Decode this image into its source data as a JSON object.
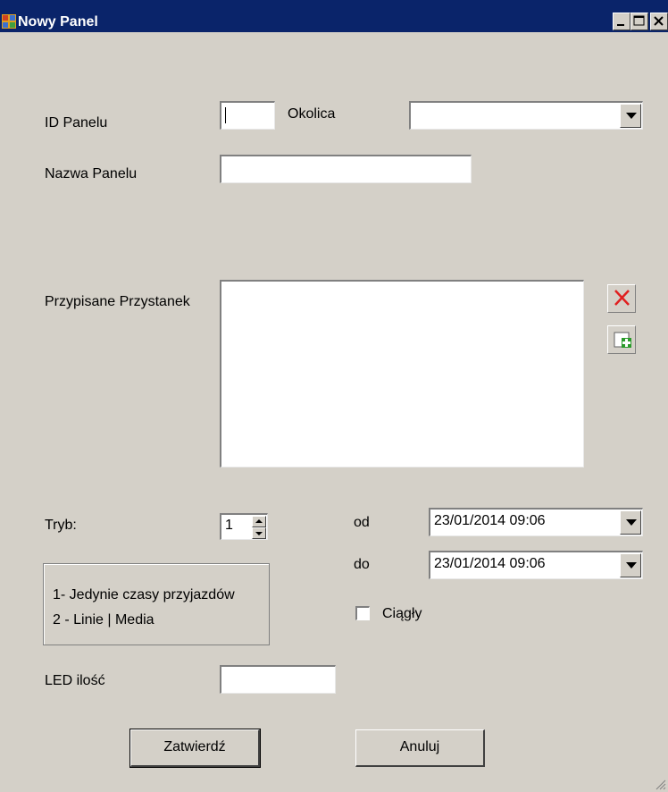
{
  "window": {
    "title": "Nowy Panel"
  },
  "labels": {
    "id_panelu": "ID Panelu",
    "okolica": "Okolica",
    "nazwa_panelu": "Nazwa Panelu",
    "przypisane": "Przypisane Przystanek",
    "tryb": "Tryb:",
    "od": "od",
    "do": "do",
    "led": "LED ilość"
  },
  "fields": {
    "id_panelu": "",
    "okolica": "",
    "nazwa_panelu": "",
    "tryb": "1",
    "od": "23/01/2014 09:06",
    "do": "23/01/2014 09:06",
    "led": ""
  },
  "legend": {
    "line1": "1- Jedynie czasy przyjazdów",
    "line2": "2 - Linie | Media"
  },
  "checkbox": {
    "label": "Ciągły",
    "checked": false
  },
  "buttons": {
    "ok": "Zatwierdź",
    "cancel": "Anuluj"
  },
  "icons": {
    "delete": "red-x-icon",
    "add": "add-item-icon",
    "app": "window-app-icon"
  },
  "colors": {
    "titlebar": "#0a246a",
    "face": "#d4d0c8",
    "delete_icon": "#e02020",
    "add_icon": "#2a9a2a"
  }
}
